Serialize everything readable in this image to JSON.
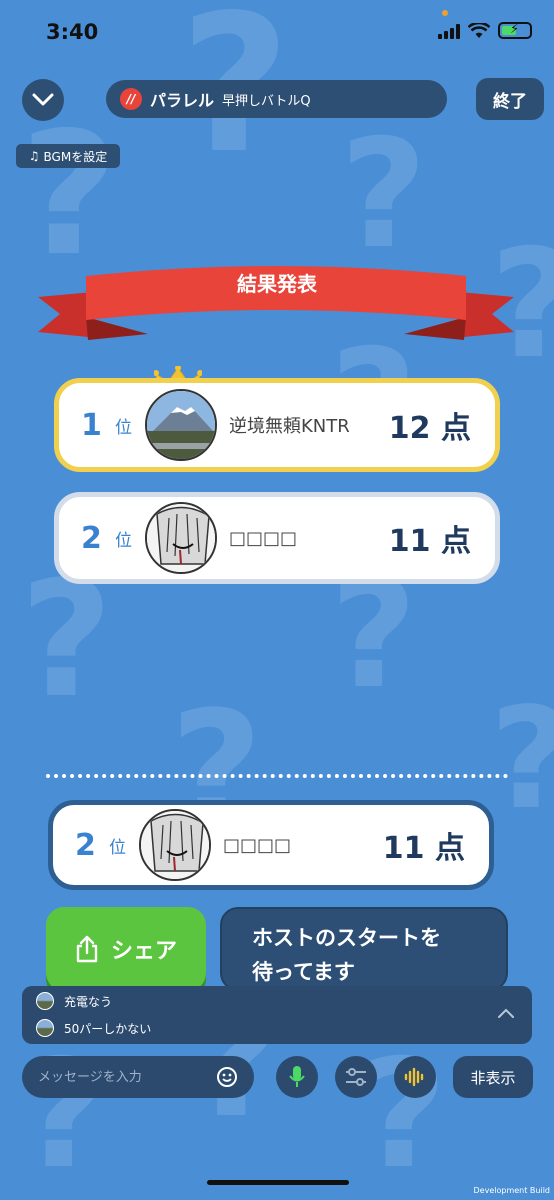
{
  "status": {
    "time": "3:40"
  },
  "header": {
    "title": "パラレル",
    "subtitle": "早押しバトルQ",
    "end_label": "終了",
    "bgm_label": "BGMを設定"
  },
  "results": {
    "banner": "結果発表",
    "rows": [
      {
        "rank": "1",
        "rank_unit": "位",
        "name": "逆境無頼KNTR",
        "score": "12 点"
      },
      {
        "rank": "2",
        "rank_unit": "位",
        "name": "□□□□",
        "score": "11 点"
      }
    ],
    "self": {
      "rank": "2",
      "rank_unit": "位",
      "name": "□□□□",
      "score": "11 点"
    }
  },
  "actions": {
    "share_label": "シェア",
    "wait_line1": "ホストのスタートを",
    "wait_line2": "待ってます"
  },
  "chat": {
    "messages": [
      "充電なう",
      "50パーしかない"
    ],
    "input_placeholder": "メッセージを入力",
    "hide_label": "非表示"
  },
  "footer": {
    "build": "Development Build"
  },
  "colors": {
    "background": "#4a8fd6",
    "panel": "#2e4f74",
    "share": "#5cc540",
    "ribbon": "#e8443a",
    "gold": "#f1d04e"
  }
}
